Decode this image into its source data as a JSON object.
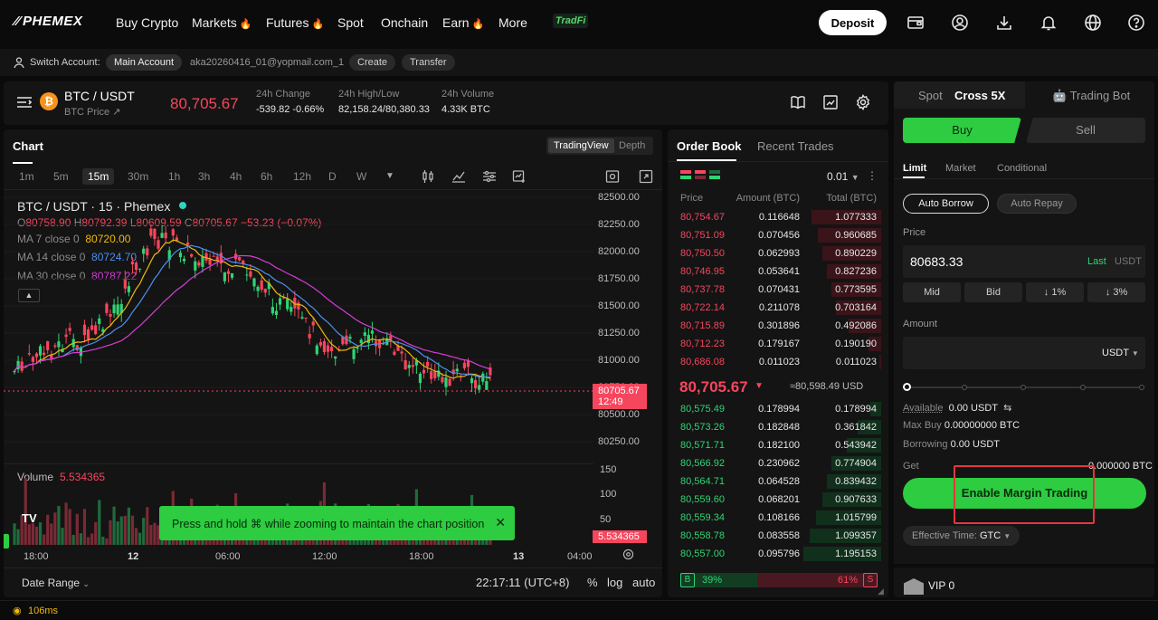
{
  "nav": {
    "logo": "PHEMEX",
    "items": [
      {
        "label": "Buy Crypto",
        "fire": false
      },
      {
        "label": "Markets",
        "fire": true
      },
      {
        "label": "Futures",
        "fire": true
      },
      {
        "label": "Spot",
        "fire": false
      },
      {
        "label": "Onchain",
        "fire": false
      },
      {
        "label": "Earn",
        "fire": true
      },
      {
        "label": "More",
        "fire": false
      }
    ],
    "tradfi": "TradFi",
    "deposit": "Deposit"
  },
  "account": {
    "switch_label": "Switch Account:",
    "main_account": "Main Account",
    "email": "aka20260416_01@yopmail.com_1",
    "create": "Create",
    "transfer": "Transfer"
  },
  "ticker": {
    "pair": "BTC / USDT",
    "sub": "BTC Price ↗",
    "price": "80,705.67",
    "change_label": "24h Change",
    "change_value": "-539.82 -0.66%",
    "hilo_label": "24h High/Low",
    "hilo_value": "82,158.24/80,380.33",
    "vol_label": "24h Volume",
    "vol_value": "4.33K BTC"
  },
  "chart": {
    "tab": "Chart",
    "view_tradingview": "TradingView",
    "view_depth": "Depth",
    "timeframes": [
      "1m",
      "5m",
      "15m",
      "30m",
      "1h",
      "3h",
      "4h",
      "6h",
      "12h",
      "D",
      "W"
    ],
    "active_timeframe": "15m",
    "symbol_line": "BTC / USDT · 15 · Phemex",
    "ohlc": {
      "o": "80758.90",
      "h": "80792.39",
      "l": "80609.59",
      "c": "80705.67",
      "chg": "−53.23 (−0.07%)"
    },
    "ma7": {
      "label": "MA 7 close 0",
      "value": "80720.00",
      "color": "#f0b90b"
    },
    "ma14": {
      "label": "MA 14 close 0",
      "value": "80724.70",
      "color": "#4d8ff0"
    },
    "ma30": {
      "label": "MA 30 close 0",
      "value": "80787.22",
      "color": "#d63dd6"
    },
    "price_ticks": [
      "82500.00",
      "82250.00",
      "82000.00",
      "81750.00",
      "81500.00",
      "81250.00",
      "81000.00",
      "80750.00",
      "80500.00",
      "80250.00"
    ],
    "last_price_tag": "80705.67",
    "last_price_timer": "12:49",
    "volume_label": "Volume",
    "volume_value": "5.534365",
    "volume_ticks": [
      "150",
      "100",
      "50"
    ],
    "volume_tag": "5.534365",
    "time_ticks": [
      "18:00",
      "12",
      "06:00",
      "12:00",
      "18:00",
      "13",
      "04:00"
    ],
    "date_range": "Date Range",
    "clock": "22:17:11 (UTC+8)",
    "pct": "%",
    "log": "log",
    "auto": "auto",
    "toast": "Press and hold ⌘ while zooming to maintain the chart position"
  },
  "orderbook": {
    "tab_book": "Order Book",
    "tab_trades": "Recent Trades",
    "precision": "0.01",
    "col_price": "Price",
    "col_amount": "Amount (BTC)",
    "col_total": "Total (BTC)",
    "asks": [
      {
        "price": "80,754.67",
        "amount": "0.116648",
        "total": "1.077333",
        "depth": 0.32
      },
      {
        "price": "80,751.09",
        "amount": "0.070456",
        "total": "0.960685",
        "depth": 0.29
      },
      {
        "price": "80,750.50",
        "amount": "0.062993",
        "total": "0.890229",
        "depth": 0.27
      },
      {
        "price": "80,746.95",
        "amount": "0.053641",
        "total": "0.827236",
        "depth": 0.25
      },
      {
        "price": "80,737.78",
        "amount": "0.070431",
        "total": "0.773595",
        "depth": 0.23
      },
      {
        "price": "80,722.14",
        "amount": "0.211078",
        "total": "0.703164",
        "depth": 0.21
      },
      {
        "price": "80,715.89",
        "amount": "0.301896",
        "total": "0.492086",
        "depth": 0.15
      },
      {
        "price": "80,712.23",
        "amount": "0.179167",
        "total": "0.190190",
        "depth": 0.06
      },
      {
        "price": "80,686.08",
        "amount": "0.011023",
        "total": "0.011023",
        "depth": 0.01
      }
    ],
    "mid_price": "80,705.67",
    "mid_usd": "≈80,598.49 USD",
    "bids": [
      {
        "price": "80,575.49",
        "amount": "0.178994",
        "total": "0.178994",
        "depth": 0.05
      },
      {
        "price": "80,573.26",
        "amount": "0.182848",
        "total": "0.361842",
        "depth": 0.11
      },
      {
        "price": "80,571.71",
        "amount": "0.182100",
        "total": "0.543942",
        "depth": 0.16
      },
      {
        "price": "80,566.92",
        "amount": "0.230962",
        "total": "0.774904",
        "depth": 0.23
      },
      {
        "price": "80,564.71",
        "amount": "0.064528",
        "total": "0.839432",
        "depth": 0.25
      },
      {
        "price": "80,559.60",
        "amount": "0.068201",
        "total": "0.907633",
        "depth": 0.27
      },
      {
        "price": "80,559.34",
        "amount": "0.108166",
        "total": "1.015799",
        "depth": 0.3
      },
      {
        "price": "80,558.78",
        "amount": "0.083558",
        "total": "1.099357",
        "depth": 0.33
      },
      {
        "price": "80,557.00",
        "amount": "0.095796",
        "total": "1.195153",
        "depth": 0.36
      }
    ],
    "buy_badge": "B",
    "sell_badge": "S",
    "buy_pct": "39%",
    "sell_pct": "61%",
    "buy_ratio": 0.39
  },
  "trade": {
    "tab_spot": "Spot",
    "tab_cross": "Cross 5X",
    "tab_bot": "Trading Bot",
    "buy": "Buy",
    "sell": "Sell",
    "order_types": [
      "Limit",
      "Market",
      "Conditional"
    ],
    "auto_borrow": "Auto Borrow",
    "auto_repay": "Auto Repay",
    "price_label": "Price",
    "price_value": "80683.33",
    "last": "Last",
    "price_unit": "USDT",
    "quick": [
      "Mid",
      "Bid",
      "↓ 1%",
      "↓ 3%"
    ],
    "amount_label": "Amount",
    "amount_unit": "USDT",
    "available_label": "Available",
    "available_value": "0.00 USDT",
    "max_buy_label": "Max Buy",
    "max_buy_value": "0.00000000 BTC",
    "borrowing_label": "Borrowing",
    "borrowing_value": "0.00 USDT",
    "get_label": "Get",
    "get_value": "0.000000 BTC",
    "enable_btn": "Enable Margin Trading",
    "effective_label": "Effective Time:",
    "effective_value": "GTC",
    "vip": "VIP 0"
  },
  "status": {
    "latency": "106ms"
  },
  "colors": {
    "green": "#2ed573",
    "red": "#f6465d",
    "brand_green": "#2ecc40"
  }
}
